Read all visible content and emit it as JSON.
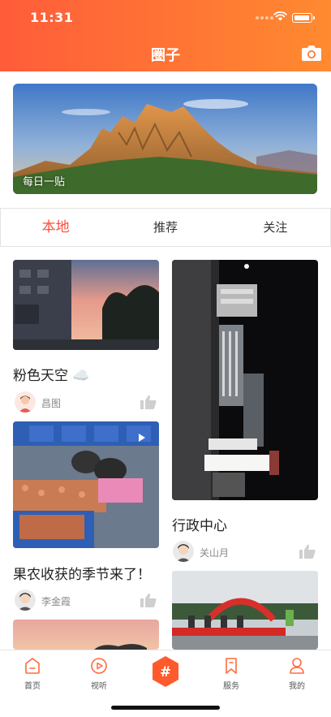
{
  "status_bar": {
    "time": "11:31"
  },
  "header": {
    "title": "圈子",
    "camera_icon": "camera-icon"
  },
  "banner": {
    "label": "每日一贴"
  },
  "tabs": [
    {
      "label": "本地",
      "active": true
    },
    {
      "label": "推荐",
      "active": false
    },
    {
      "label": "关注",
      "active": false
    }
  ],
  "feed": {
    "left": [
      {
        "title": "粉色天空 ☁️",
        "author": "昌图"
      },
      {
        "title": "果农收获的季节来了！",
        "author": "李金霞"
      }
    ],
    "right": [
      {
        "title": "行政中心",
        "author": "关山月"
      }
    ]
  },
  "bottom_nav": [
    {
      "label": "首页",
      "icon": "home-icon"
    },
    {
      "label": "视听",
      "icon": "play-icon"
    },
    {
      "label": "#",
      "icon": "hashtag-icon"
    },
    {
      "label": "服务",
      "icon": "bookmark-icon"
    },
    {
      "label": "我的",
      "icon": "profile-icon"
    }
  ],
  "colors": {
    "accent": "#ff4d3b",
    "header_start": "#ff5c3a",
    "header_end": "#ff8a30"
  }
}
